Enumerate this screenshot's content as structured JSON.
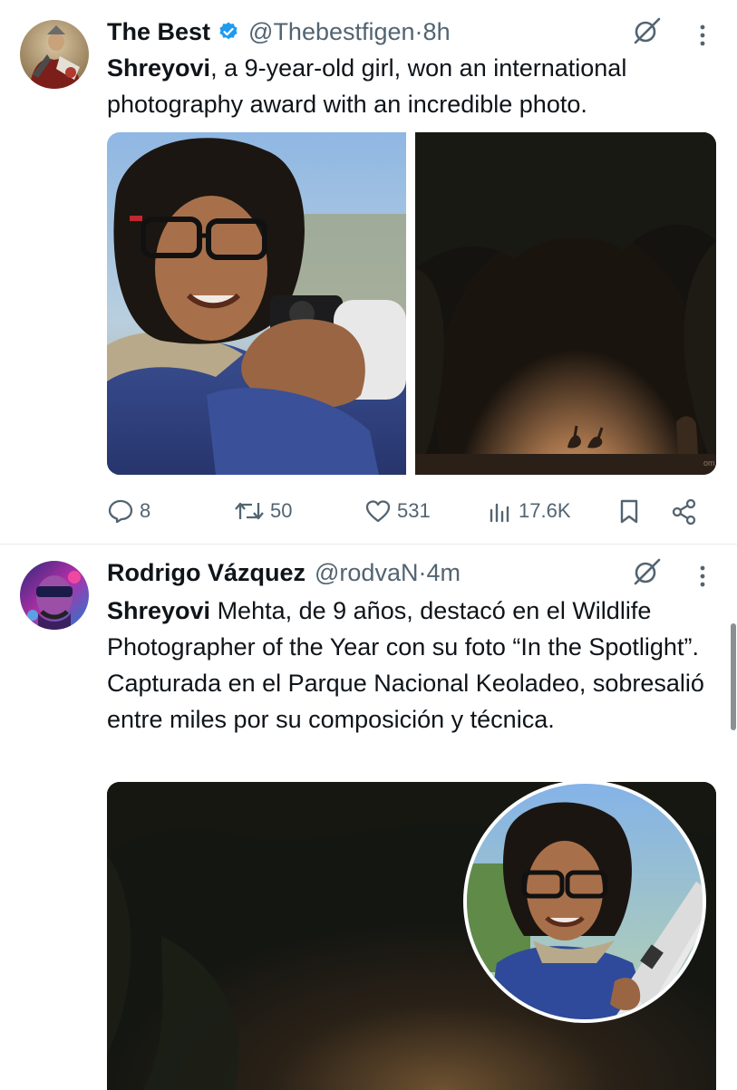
{
  "tweets": [
    {
      "author_name": "The Best",
      "handle": "@Thebestfigen",
      "separator": " · ",
      "time": "8h",
      "verified": true,
      "text_bold": "Shreyovi",
      "text_rest": ", a 9-year-old girl, won an international photography award with an incredible photo.",
      "images": [
        "girl-with-camera-photo",
        "forest-peacocks-photo"
      ],
      "actions": {
        "replies": "8",
        "reposts": "50",
        "likes": "531",
        "views": "17.6K"
      },
      "image_watermark": "om"
    },
    {
      "author_name": "Rodrigo Vázquez",
      "handle": "@rodvaN",
      "separator": " · ",
      "time": "4m",
      "verified": false,
      "text_bold": "Shreyovi",
      "text_rest": " Mehta, de 9 años, destacó en el Wildlife Photographer of the Year con su foto “In the Spotlight”. Capturada en el Parque Nacional Keoladeo, sobresalió entre miles por su composición y técnica.",
      "images": [
        "forest-with-girl-inset-photo"
      ]
    }
  ],
  "icons": {
    "verified": "verified-badge-icon",
    "grok": "grok-icon",
    "more": "more-vertical-icon",
    "reply": "reply-icon",
    "repost": "repost-icon",
    "like": "heart-icon",
    "views": "views-icon",
    "bookmark": "bookmark-icon",
    "share": "share-icon"
  },
  "colors": {
    "text": "#0f1419",
    "secondary": "#536471",
    "verified": "#1d9bf0",
    "divider": "#e6ecf0"
  }
}
